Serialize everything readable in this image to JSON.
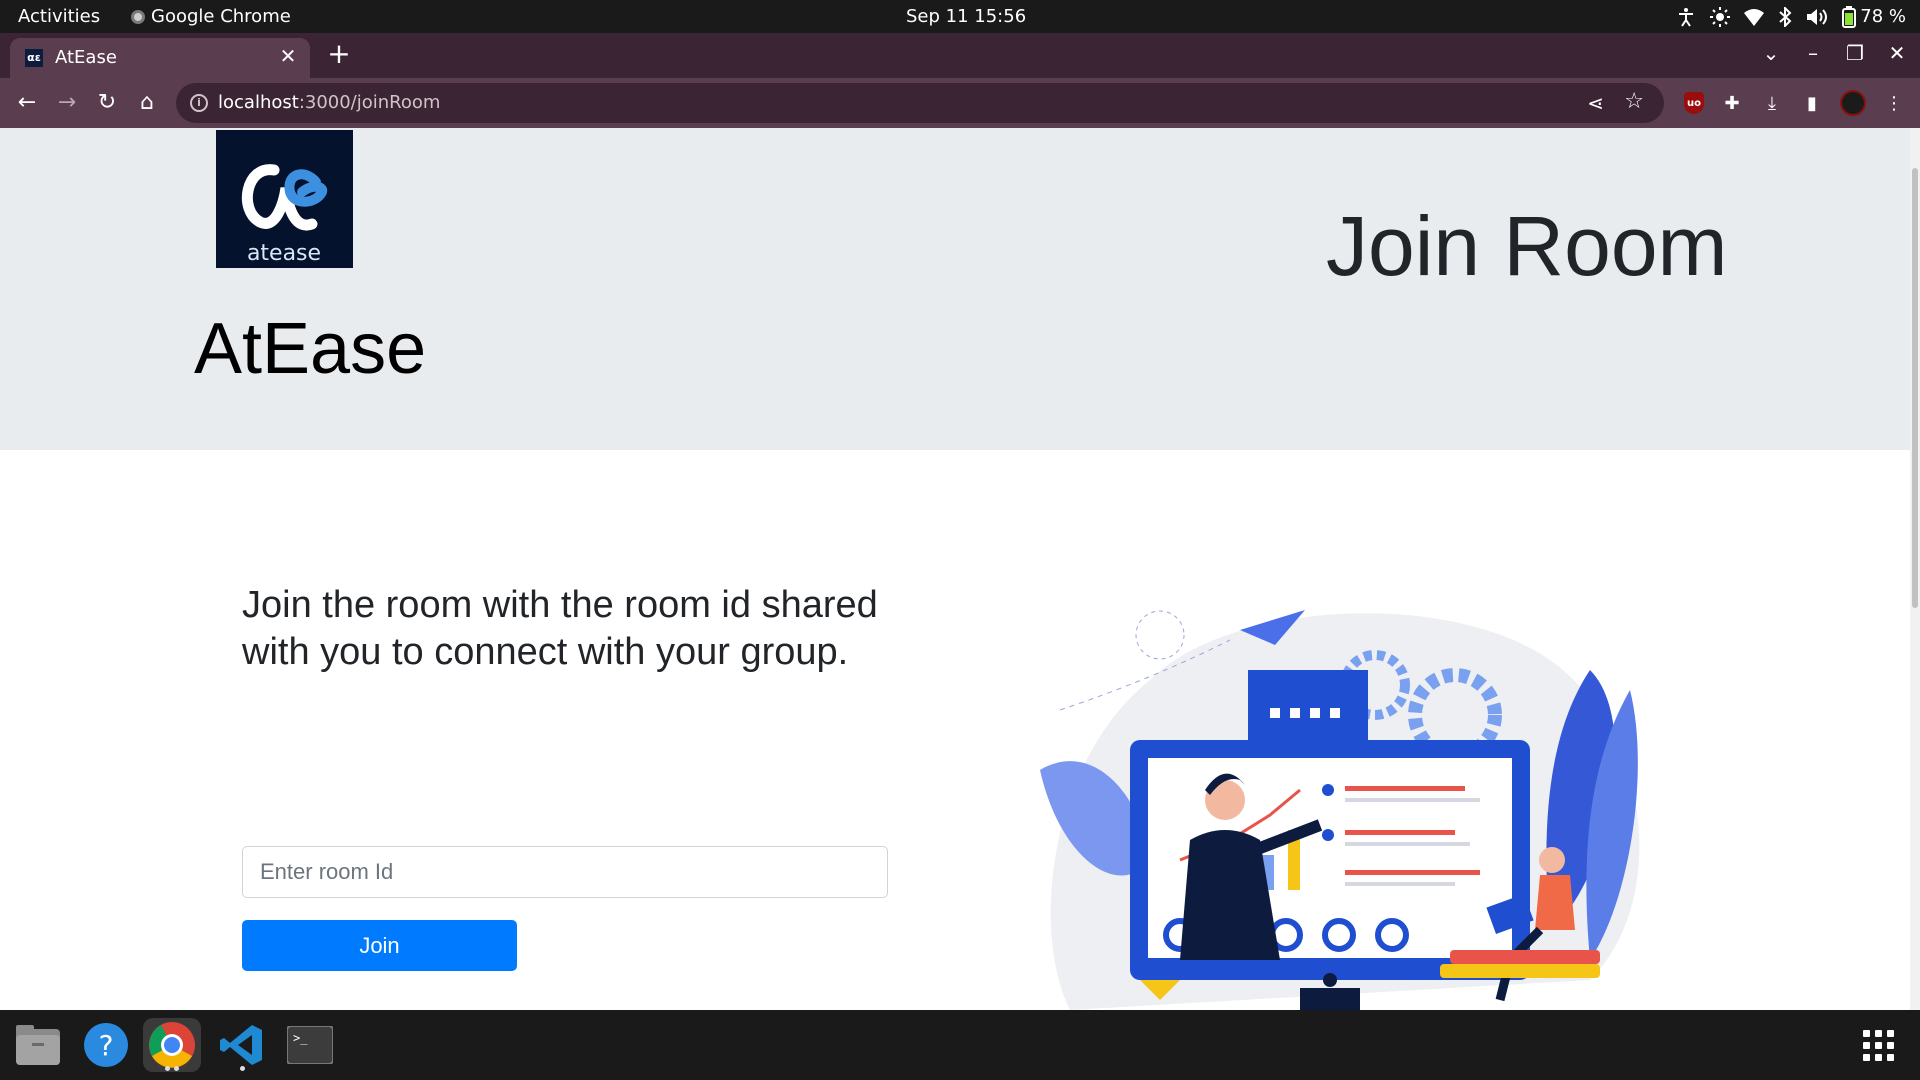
{
  "system_bar": {
    "activities": "Activities",
    "app_name": "Google Chrome",
    "clock": "Sep 11  15:56",
    "battery_percent": "78 %"
  },
  "browser": {
    "tab": {
      "favicon_text": "αε",
      "title": "AtEase"
    },
    "url_host": "localhost",
    "url_path": ":3000/joinRoom",
    "ublock_text": "uo"
  },
  "page": {
    "brand_name": "AtEase",
    "logo_text": "atease",
    "title": "Join Room",
    "tagline": "Join the room with the room id shared with you to connect with your group.",
    "room_input": {
      "placeholder": "Enter room Id",
      "value": ""
    },
    "join_button": "Join"
  },
  "colors": {
    "header_bg": "#e9ecef",
    "primary_button": "#007bff",
    "chrome_frame": "#3b2433",
    "chrome_toolbar": "#5a3d4f"
  },
  "dock": {
    "items": [
      "files-icon",
      "help-icon",
      "chrome-icon",
      "vscode-icon",
      "terminal-icon"
    ]
  }
}
